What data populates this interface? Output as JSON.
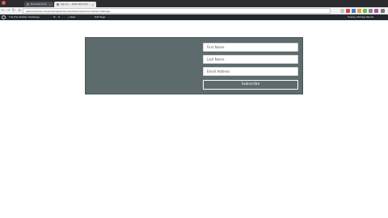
{
  "browser": {
    "tabs": [
      {
        "title": "Mail Mailchimp Subscribe Form",
        "close": "×"
      },
      {
        "title": "Sign up — Subscribe Form — Kit Free Builder Challenge",
        "close": "×"
      }
    ],
    "url": "www.example.com/wordpress/index.php?subscribe-form-builder-challenge",
    "nav": {
      "back": "←",
      "forward": "→",
      "reload": "↻",
      "home": "⌂"
    }
  },
  "admin_bar": {
    "site_name": "The Free Builder Challenge",
    "comments": "0",
    "new_label": "+ New",
    "edit_label": "Edit Page",
    "account": "Howdy, Michael Woods"
  },
  "form": {
    "first_name_placeholder": "First Name",
    "last_name_placeholder": "Last Name",
    "email_placeholder": "Email Address",
    "submit_label": "Subscribe"
  },
  "colors": {
    "panel_bg": "#5d6b6d",
    "admin_bar_bg": "#23282d",
    "tab_strip_bg": "#2b2d30"
  }
}
